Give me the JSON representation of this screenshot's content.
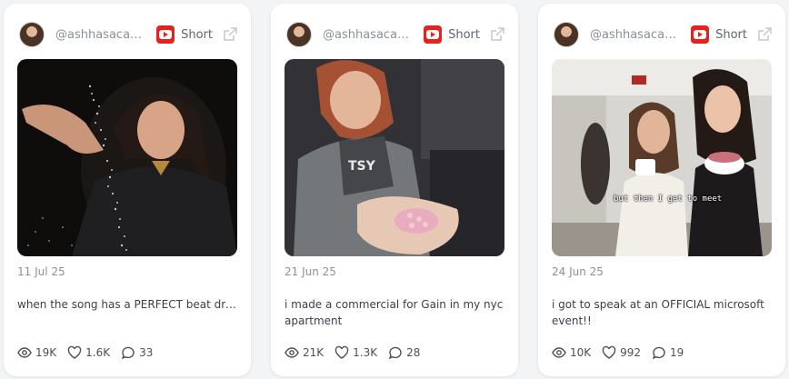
{
  "cards": [
    {
      "username": "@ashhasacam...",
      "format": "Short",
      "date": "11 Jul 25",
      "caption": "when the song has a PERFECT beat drop...",
      "views": "19K",
      "likes": "1.6K",
      "comments": "33"
    },
    {
      "username": "@ashhasacam...",
      "format": "Short",
      "date": "21 Jun 25",
      "caption": "i made a commercial for Gain in my nyc apartment",
      "views": "21K",
      "likes": "1.3K",
      "comments": "28"
    },
    {
      "username": "@ashhasacam...",
      "format": "Short",
      "date": "24 Jun 25",
      "caption": "i got to speak at an OFFICIAL microsoft event!!",
      "thumb_overlay": "but then I get to meet",
      "views": "10K",
      "likes": "992",
      "comments": "19"
    }
  ],
  "icons": {
    "platform": "youtube-icon",
    "external": "external-link-icon",
    "views": "eye-icon",
    "likes": "heart-icon",
    "comments": "comment-icon"
  },
  "colors": {
    "youtube_red": "#e6211e",
    "card_bg": "#ffffff",
    "page_bg": "#f3f4f6",
    "muted_text": "#8a8f98"
  }
}
